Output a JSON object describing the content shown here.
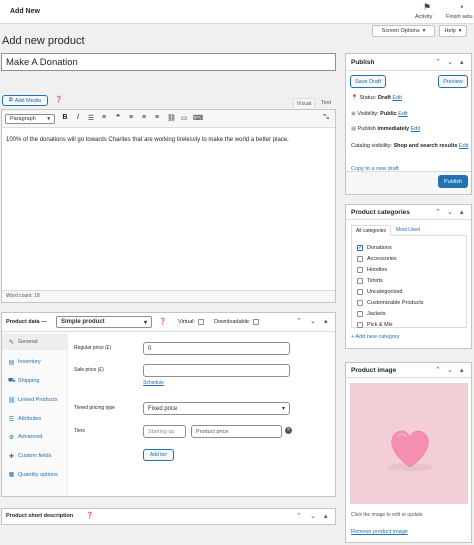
{
  "topbar": {
    "title": "Add New",
    "activity_label": "Activity",
    "finish_setup_label": "Finish setu"
  },
  "screen_options": {
    "screen_options_label": "Screen Options",
    "help_label": "Help",
    "chevron": "▾"
  },
  "page": {
    "heading": "Add new product"
  },
  "title_field": {
    "value": "Make A Donation"
  },
  "editor": {
    "add_media_label": "Add Media",
    "visual_tab": "Visual",
    "text_tab": "Text",
    "format_select": "Paragraph",
    "tool_bold": "B",
    "tool_italic": "I",
    "content": "100% of the donations will go towards Charites that are working tirelessly to make the world a better place.",
    "word_count": "Word count: 18"
  },
  "product_data": {
    "title": "Product data —",
    "type_select": "Simple product",
    "virtual_label": "Virtual:",
    "downloadable_label": "Downloadable:",
    "tabs": [
      {
        "label": "General",
        "icon": "wrench-icon",
        "glyph": "✎"
      },
      {
        "label": "Inventory",
        "icon": "inventory-icon",
        "glyph": "▤"
      },
      {
        "label": "Shipping",
        "icon": "truck-icon",
        "glyph": "⛟"
      },
      {
        "label": "Linked Products",
        "icon": "link-icon",
        "glyph": "⛓"
      },
      {
        "label": "Attributes",
        "icon": "list-icon",
        "glyph": "☰"
      },
      {
        "label": "Advanced",
        "icon": "gear-icon",
        "glyph": "⚙"
      },
      {
        "label": "Custom fields",
        "icon": "tag-icon",
        "glyph": "✚"
      },
      {
        "label": "Quantity options",
        "icon": "quantity-icon",
        "glyph": "▦"
      }
    ],
    "regular_price_label": "Regular price (£)",
    "regular_price_value": "0",
    "sale_price_label": "Sale price (£)",
    "sale_price_value": "",
    "schedule_link": "Schedule",
    "tiered_pricing_label": "Tiered pricing type",
    "tiered_pricing_value": "Fixed price",
    "tiers_label": "Tiers",
    "tiers_starting_placeholder": "Starting qu",
    "tiers_price_placeholder": "Product price",
    "add_tier_label": "Add tier"
  },
  "short_description": {
    "title": "Product short description"
  },
  "publish": {
    "title": "Publish",
    "save_draft": "Save Draft",
    "preview": "Preview",
    "status_label": "Status:",
    "status_value": "Draft",
    "visibility_label": "Visibility:",
    "visibility_value": "Public",
    "publish_label": "Publish",
    "publish_value": "immediately",
    "edit": "Edit",
    "catalog_label": "Catalog visibility:",
    "catalog_value": "Shop and search results",
    "copy_link": "Copy to a new draft",
    "publish_button": "Publish"
  },
  "categories": {
    "title": "Product categories",
    "tab_all": "All categories",
    "tab_most_used": "Most Used",
    "items": [
      {
        "label": "Donations",
        "checked": true
      },
      {
        "label": "Accessories",
        "checked": false
      },
      {
        "label": "Hoodies",
        "checked": false
      },
      {
        "label": "Tshirts",
        "checked": false
      },
      {
        "label": "Uncategorized",
        "checked": false
      },
      {
        "label": "Customizable Products",
        "checked": false
      },
      {
        "label": "Jackets",
        "checked": false
      },
      {
        "label": "Pick & Mix",
        "checked": false
      }
    ],
    "add_new_link": "+ Add new category"
  },
  "product_image": {
    "title": "Product image",
    "hint": "Click the image to edit or update",
    "remove_link": "Remove product image"
  },
  "colors": {
    "accent": "#2271b1",
    "image_bg": "#f2cfd6",
    "heart": "#f58fb1"
  }
}
